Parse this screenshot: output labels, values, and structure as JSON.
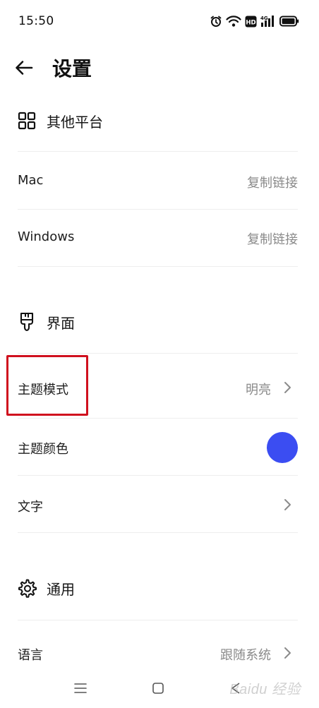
{
  "status_bar": {
    "time": "15:50",
    "icons": [
      "alarm-icon",
      "wifi-icon",
      "hd-icon",
      "4g-signal-icon",
      "battery-icon"
    ],
    "hd_label": "HD",
    "network_label": "4G"
  },
  "header": {
    "title": "设置"
  },
  "sections": {
    "platforms": {
      "title": "其他平台",
      "icon": "grid-icon",
      "rows": [
        {
          "label": "Mac",
          "value": "复制链接"
        },
        {
          "label": "Windows",
          "value": "复制链接"
        }
      ]
    },
    "interface": {
      "title": "界面",
      "icon": "brush-icon",
      "rows": [
        {
          "label": "主题模式",
          "value": "明亮"
        },
        {
          "label": "主题颜色",
          "value": ""
        },
        {
          "label": "文字",
          "value": ""
        }
      ],
      "theme_color": "#3b4df2"
    },
    "general": {
      "title": "通用",
      "icon": "gear-icon",
      "rows": [
        {
          "label": "语言",
          "value": "跟随系统"
        }
      ]
    }
  },
  "watermark": "Baidu 经验",
  "colors": {
    "highlight": "#d0101e",
    "accent": "#3b4df2",
    "muted_text": "#8a8a8a",
    "divider": "#eeeeee"
  }
}
